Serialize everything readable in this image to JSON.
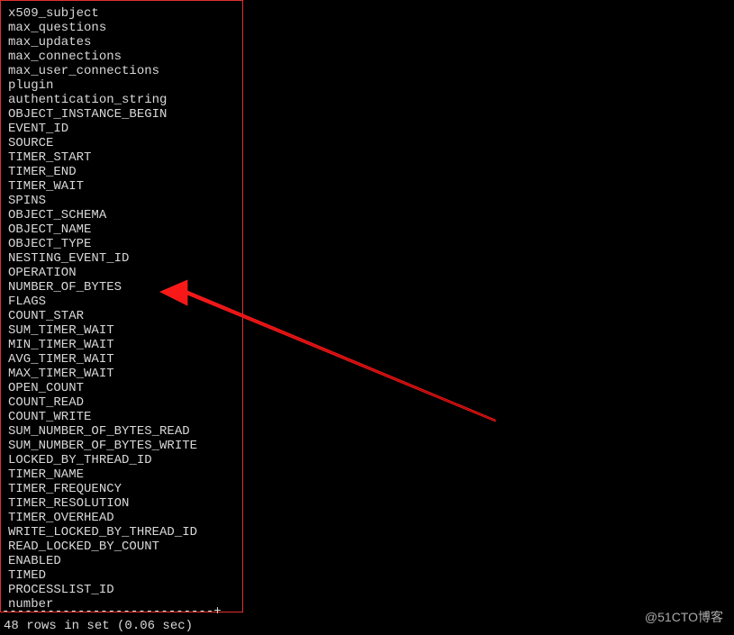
{
  "terminal": {
    "columns": [
      "x509_subject",
      "max_questions",
      "max_updates",
      "max_connections",
      "max_user_connections",
      "plugin",
      "authentication_string",
      "OBJECT_INSTANCE_BEGIN",
      "EVENT_ID",
      "SOURCE",
      "TIMER_START",
      "TIMER_END",
      "TIMER_WAIT",
      "SPINS",
      "OBJECT_SCHEMA",
      "OBJECT_NAME",
      "OBJECT_TYPE",
      "NESTING_EVENT_ID",
      "OPERATION",
      "NUMBER_OF_BYTES",
      "FLAGS",
      "COUNT_STAR",
      "SUM_TIMER_WAIT",
      "MIN_TIMER_WAIT",
      "AVG_TIMER_WAIT",
      "MAX_TIMER_WAIT",
      "OPEN_COUNT",
      "COUNT_READ",
      "COUNT_WRITE",
      "SUM_NUMBER_OF_BYTES_READ",
      "SUM_NUMBER_OF_BYTES_WRITE",
      "LOCKED_BY_THREAD_ID",
      "TIMER_NAME",
      "TIMER_FREQUENCY",
      "TIMER_RESOLUTION",
      "TIMER_OVERHEAD",
      "WRITE_LOCKED_BY_THREAD_ID",
      "READ_LOCKED_BY_COUNT",
      "ENABLED",
      "TIMED",
      "PROCESSLIST_ID",
      "number"
    ],
    "separator": "----------------------------+",
    "status": "48 rows in set (0.06 sec)"
  },
  "watermark": "@51CTO博客"
}
